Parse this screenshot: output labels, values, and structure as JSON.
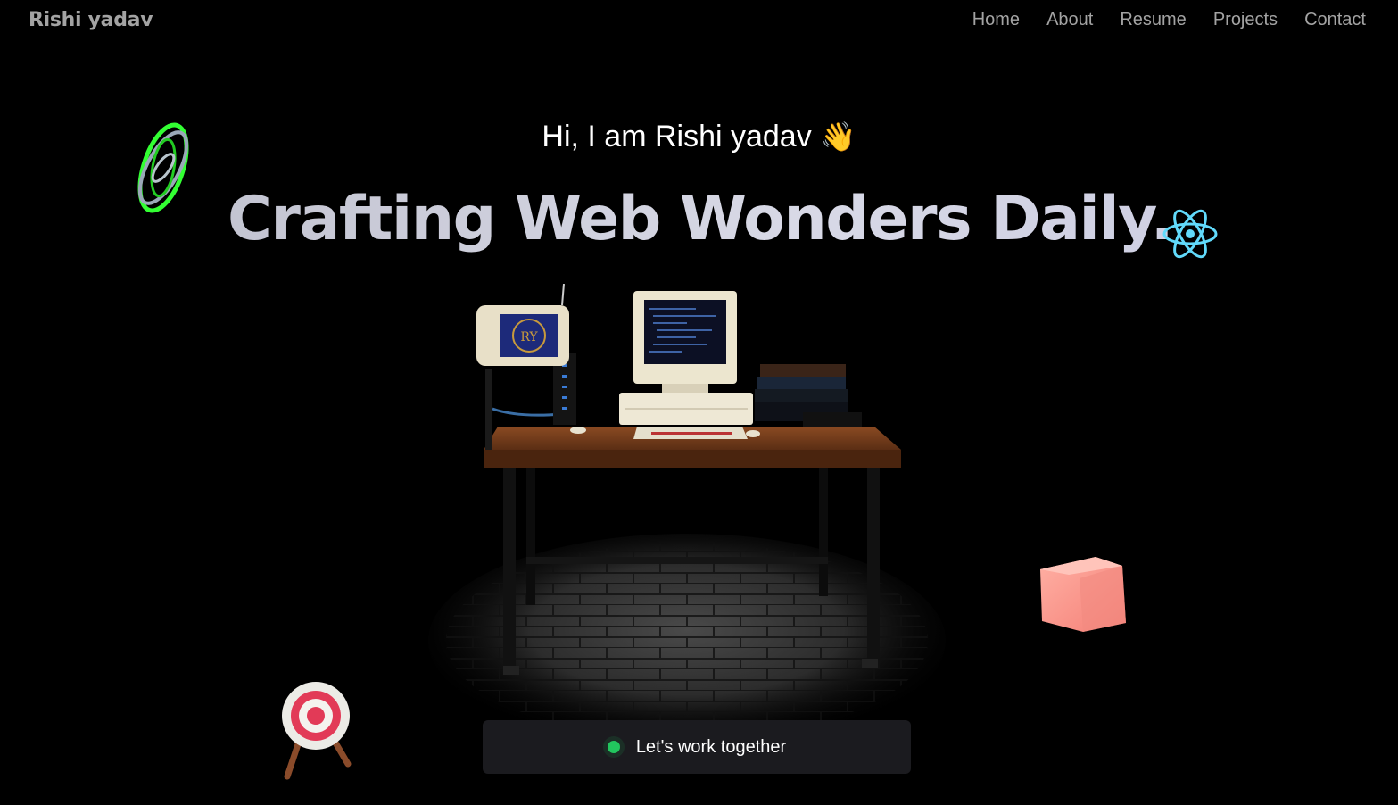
{
  "navbar": {
    "logo": "Rishi yadav",
    "links": [
      "Home",
      "About",
      "Resume",
      "Projects",
      "Contact"
    ]
  },
  "hero": {
    "greeting": "Hi, I am Rishi yadav",
    "wave_emoji": "👋",
    "headline": "Crafting Web Wonders Daily."
  },
  "scene": {
    "monitor_badge": "RY"
  },
  "cta": {
    "label": "Let's work together",
    "status_color": "#22c55e"
  },
  "icons": {
    "rings": "rings-icon",
    "react": "react-icon",
    "cube": "cube-icon",
    "target": "target-icon",
    "desk": "desk-scene"
  },
  "colors": {
    "background": "#000000",
    "nav_text": "#a3a3a3",
    "headline": "#d0d1e0",
    "accent_green": "#22c55e",
    "cube": "#f8938a",
    "react": "#61dafb"
  }
}
